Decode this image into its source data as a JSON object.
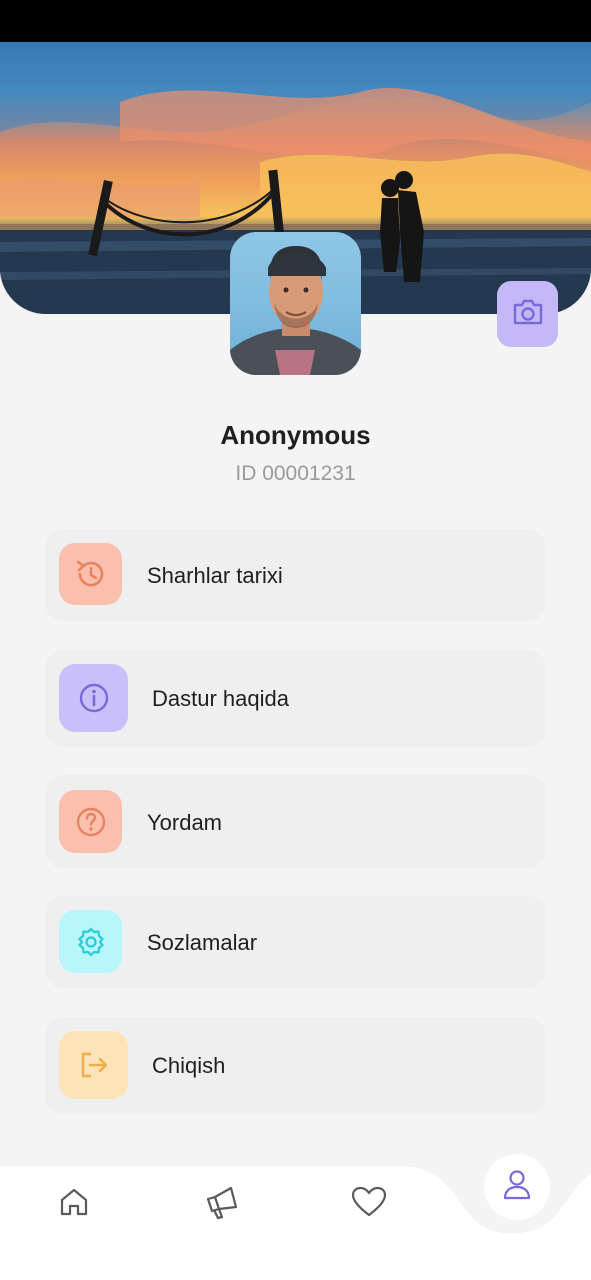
{
  "profile": {
    "name": "Anonymous",
    "id_text": "ID 00001231"
  },
  "menu": [
    {
      "label": "Sharhlar tarixi",
      "icon": "history-icon",
      "icon_bg": "#fac0ad",
      "icon_color": "#e8835f"
    },
    {
      "label": "Dastur haqida",
      "icon": "info-icon",
      "icon_bg": "#c9c0fb",
      "icon_color": "#7b68d8"
    },
    {
      "label": "Yordam",
      "icon": "help-icon",
      "icon_bg": "#fac0ad",
      "icon_color": "#e8835f"
    },
    {
      "label": "Sozlamalar",
      "icon": "settings-icon",
      "icon_bg": "#b7f6fb",
      "icon_color": "#2bcad8"
    },
    {
      "label": "Chiqish",
      "icon": "logout-icon",
      "icon_bg": "#fde4b8",
      "icon_color": "#f0ae45"
    }
  ],
  "bottom_nav": [
    {
      "name": "home",
      "icon": "home-icon"
    },
    {
      "name": "announcements",
      "icon": "megaphone-icon"
    },
    {
      "name": "favorites",
      "icon": "heart-icon"
    },
    {
      "name": "profile",
      "icon": "user-icon",
      "active": true
    }
  ],
  "colors": {
    "accent": "#7b68d8",
    "background": "#f4f4f4",
    "card": "#efefef"
  }
}
